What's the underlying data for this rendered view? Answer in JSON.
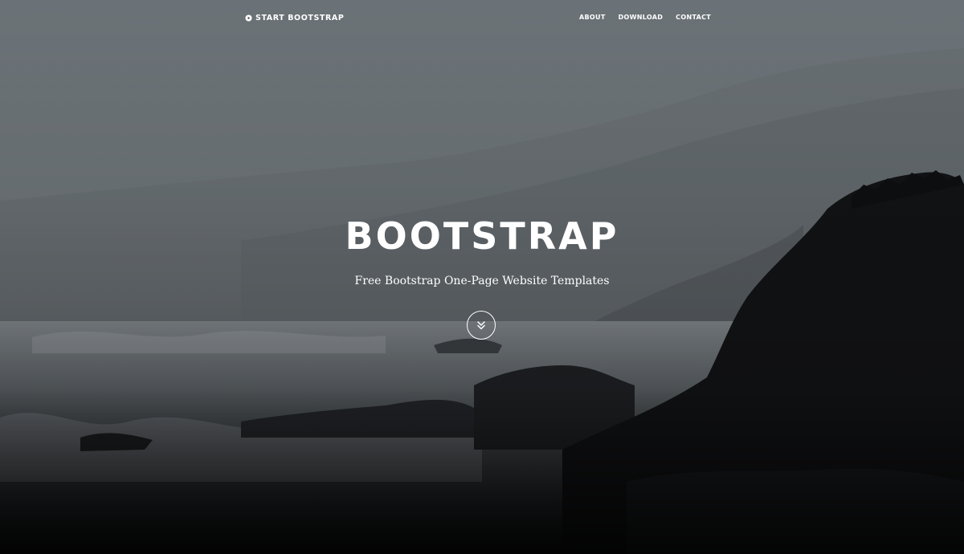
{
  "navbar": {
    "brand_label": "START BOOTSTRAP",
    "brand_icon": "play-circle-icon",
    "links": [
      {
        "label": "ABOUT"
      },
      {
        "label": "DOWNLOAD"
      },
      {
        "label": "CONTACT"
      }
    ]
  },
  "intro": {
    "heading": "BOOTSTRAP",
    "subheading": "Free Bootstrap One-Page Website Templates",
    "scroll_icon": "double-chevron-down-icon"
  },
  "colors": {
    "text": "#ffffff",
    "background_top": "#6d7479",
    "background_bottom": "#0b0c0e"
  }
}
